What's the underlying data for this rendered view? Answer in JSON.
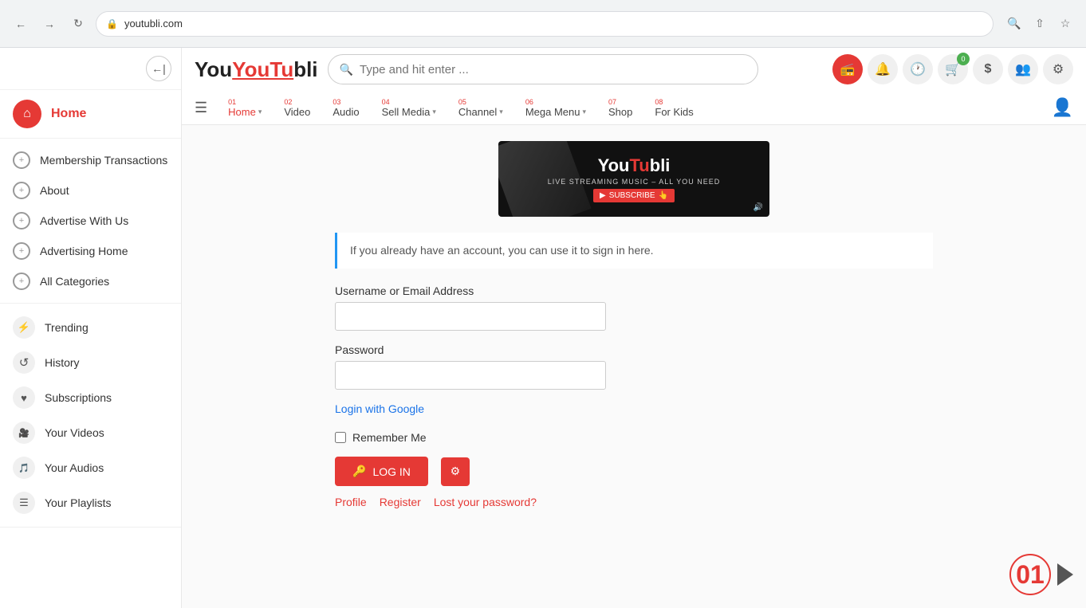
{
  "browser": {
    "url": "youtubli.com",
    "back_title": "Back",
    "forward_title": "Forward",
    "refresh_title": "Refresh"
  },
  "sidebar": {
    "toggle_label": "←|",
    "home_label": "Home",
    "menu_items": [
      {
        "label": "Membership Transactions"
      },
      {
        "label": "About"
      },
      {
        "label": "Advertise With Us"
      },
      {
        "label": "Advertising Home"
      },
      {
        "label": "All Categories"
      }
    ],
    "section_items": [
      {
        "label": "Trending",
        "icon": "⚡"
      },
      {
        "label": "History",
        "icon": "↺"
      },
      {
        "label": "Subscriptions",
        "icon": "♥"
      },
      {
        "label": "Your Videos",
        "icon": "🎥"
      },
      {
        "label": "Your Audios",
        "icon": "🎵"
      },
      {
        "label": "Your Playlists",
        "icon": "☰"
      }
    ]
  },
  "logo": {
    "you": "You",
    "tube": "YouTu",
    "bli": "bli"
  },
  "search": {
    "placeholder": "Type and hit enter ..."
  },
  "nav_icons": {
    "radio_label": "📻",
    "bell_label": "🔔",
    "clock_label": "🕐",
    "cart_label": "🛒",
    "cart_badge": "0",
    "dollar_label": "$",
    "users_label": "👥",
    "settings_label": "⚙"
  },
  "top_nav": {
    "menu_items": [
      {
        "num": "01",
        "label": "Home",
        "active": true,
        "has_arrow": true
      },
      {
        "num": "02",
        "label": "Video",
        "active": false,
        "has_arrow": false
      },
      {
        "num": "03",
        "label": "Audio",
        "active": false,
        "has_arrow": false
      },
      {
        "num": "04",
        "label": "Sell Media",
        "active": false,
        "has_arrow": true
      },
      {
        "num": "05",
        "label": "Channel",
        "active": false,
        "has_arrow": true
      },
      {
        "num": "06",
        "label": "Mega Menu",
        "active": false,
        "has_arrow": true
      },
      {
        "num": "07",
        "label": "Shop",
        "active": false,
        "has_arrow": false
      },
      {
        "num": "08",
        "label": "For Kids",
        "active": false,
        "has_arrow": false
      }
    ]
  },
  "main": {
    "banner": {
      "logo_text": "YouTubli",
      "subtitle": "LIVE STREAMING MUSIC – ALL YOU NEED",
      "subscribe_label": "SUBSCRIBE"
    },
    "info_text": "If you already have an account, you can use it to sign in here.",
    "form": {
      "username_label": "Username or Email Address",
      "username_placeholder": "",
      "password_label": "Password",
      "password_placeholder": "",
      "google_login_label": "Login with Google",
      "remember_label": "Remember Me",
      "login_btn_label": "LOG IN"
    },
    "bottom_links": {
      "profile": "Profile",
      "register": "Register",
      "lost_password": "Lost your password?"
    }
  },
  "counter": {
    "num": "01"
  }
}
